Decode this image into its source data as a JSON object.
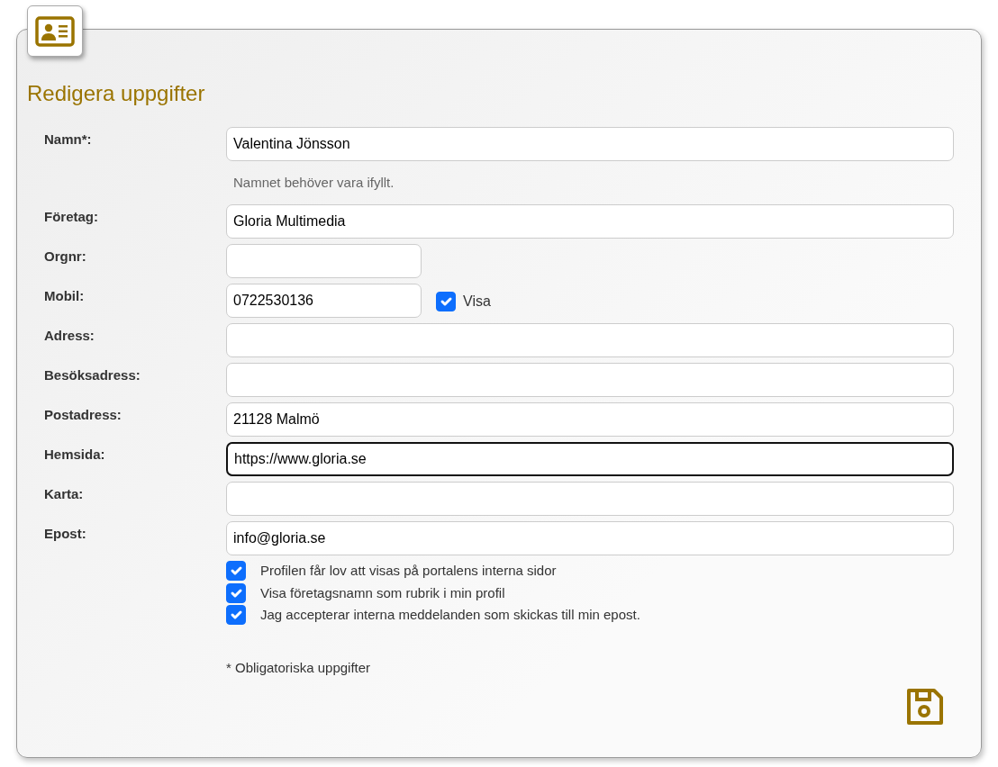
{
  "title": "Redigera uppgifter",
  "fields": [
    {
      "label": "Namn*:",
      "value": "Valentina Jönsson",
      "kind": "wide",
      "focused": false,
      "hint": "Namnet behöver vara ifyllt."
    },
    {
      "label": "Företag:",
      "value": "Gloria Multimedia",
      "kind": "wide",
      "focused": false
    },
    {
      "label": "Orgnr:",
      "kind": "narrow",
      "focused": false
    },
    {
      "label": "Mobil:",
      "value": "0722530136",
      "kind": "narrow",
      "focused": false,
      "option": {
        "label": "Visa",
        "checked": true
      }
    },
    {
      "label": "Adress:",
      "kind": "wide",
      "focused": false
    },
    {
      "label": "Besöksadress:",
      "kind": "wide",
      "focused": false
    },
    {
      "label": "Postadress:",
      "value": "21128 Malmö",
      "kind": "wide",
      "focused": false
    },
    {
      "label": "Hemsida:",
      "value": "https://www.gloria.se",
      "kind": "wide",
      "focused": true
    },
    {
      "label": "Karta:",
      "kind": "wide",
      "focused": false
    },
    {
      "label": "Epost:",
      "value": "info@gloria.se",
      "kind": "wide",
      "focused": false
    }
  ],
  "consents": [
    {
      "label": "Profilen får lov att visas på portalens interna sidor",
      "checked": true
    },
    {
      "label": "Visa företagsnamn som rubrik i min profil",
      "checked": true
    },
    {
      "label": "Jag accepterar interna meddelanden som skickas till min epost.",
      "checked": true
    }
  ],
  "footnote": "* Obligatoriska uppgifter"
}
